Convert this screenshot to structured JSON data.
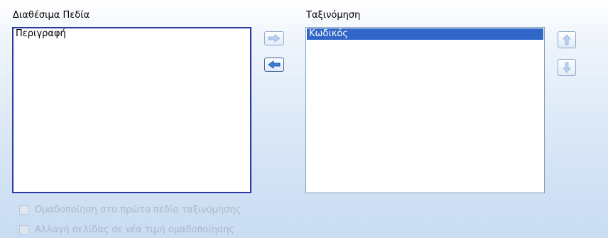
{
  "available": {
    "label": "Διαθέσιμα Πεδία",
    "items": [
      "Περιγραφή"
    ]
  },
  "sorting": {
    "label": "Ταξινόμηση",
    "items": [
      "Κωδικός"
    ],
    "selected_index": 0
  },
  "options": {
    "group_first_field": "Ομαδοποίηση στο πρώτο πεδίο ταξινόμησης",
    "page_break_on_group": "Αλλαγή σελίδας σε νέα τιμή ομαδοποίησης"
  },
  "colors": {
    "selection": "#3166c9",
    "arrow_active": "#1f5fb5",
    "arrow_disabled": "#9dbbe0"
  },
  "icons": {
    "move_right": "arrow-right-icon",
    "move_left": "arrow-left-icon",
    "move_up": "arrow-up-icon",
    "move_down": "arrow-down-icon"
  }
}
